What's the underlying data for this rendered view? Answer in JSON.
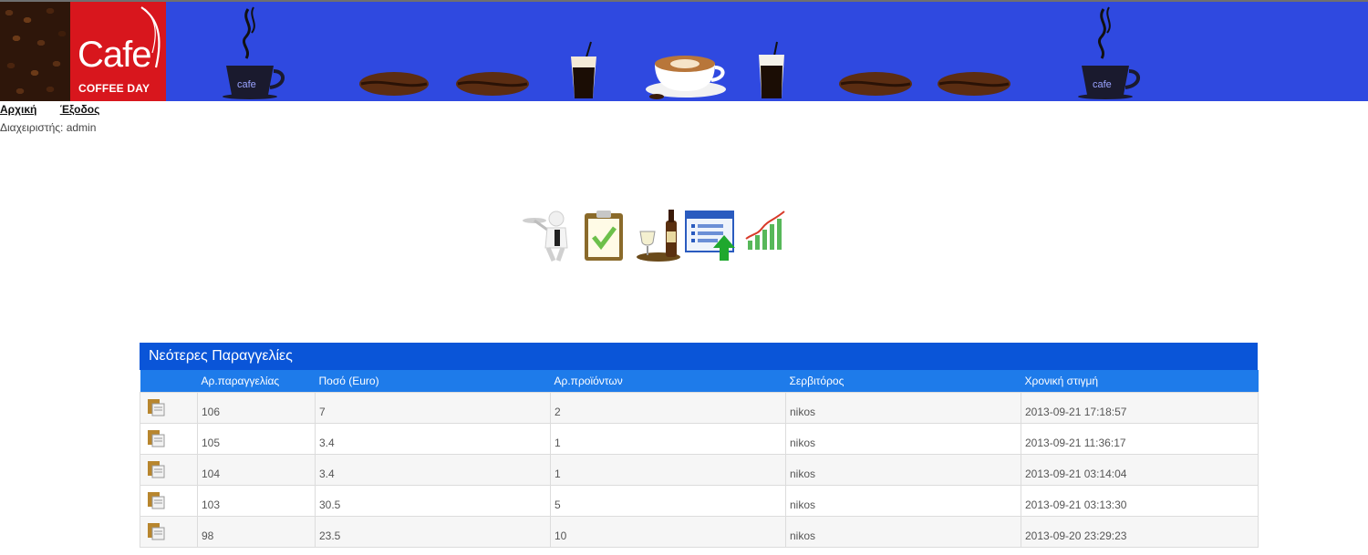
{
  "banner": {
    "logo_text": "Cafe",
    "logo_subtext": "COFFEE DAY",
    "deco_cup_text": "cafe"
  },
  "nav": {
    "home": "Αρχική",
    "logout": "Έξοδος"
  },
  "admin_line": "Διαχειριστής: admin",
  "toolbar": {
    "icons": [
      "waiter-icon",
      "checklist-icon",
      "drinks-icon",
      "upload-list-icon",
      "stats-chart-icon"
    ]
  },
  "orders": {
    "title": "Νεότερες Παραγγελίες",
    "columns": [
      "",
      "Αρ.παραγγελίας",
      "Ποσό (Euro)",
      "Αρ.προϊόντων",
      "Σερβιτόρος",
      "Χρονική στιγμή"
    ],
    "rows": [
      {
        "order_no": "106",
        "amount": "7",
        "items": "2",
        "waiter": "nikos",
        "time": "2013-09-21 17:18:57"
      },
      {
        "order_no": "105",
        "amount": "3.4",
        "items": "1",
        "waiter": "nikos",
        "time": "2013-09-21 11:36:17"
      },
      {
        "order_no": "104",
        "amount": "3.4",
        "items": "1",
        "waiter": "nikos",
        "time": "2013-09-21 03:14:04"
      },
      {
        "order_no": "103",
        "amount": "30.5",
        "items": "5",
        "waiter": "nikos",
        "time": "2013-09-21 03:13:30"
      },
      {
        "order_no": "98",
        "amount": "23.5",
        "items": "10",
        "waiter": "nikos",
        "time": "2013-09-20 23:29:23"
      }
    ]
  },
  "colors": {
    "banner_bg": "#2f49e0",
    "logo_red": "#d8161d",
    "table_title_bg": "#0a55d8",
    "table_header_bg": "#1e7bea"
  }
}
